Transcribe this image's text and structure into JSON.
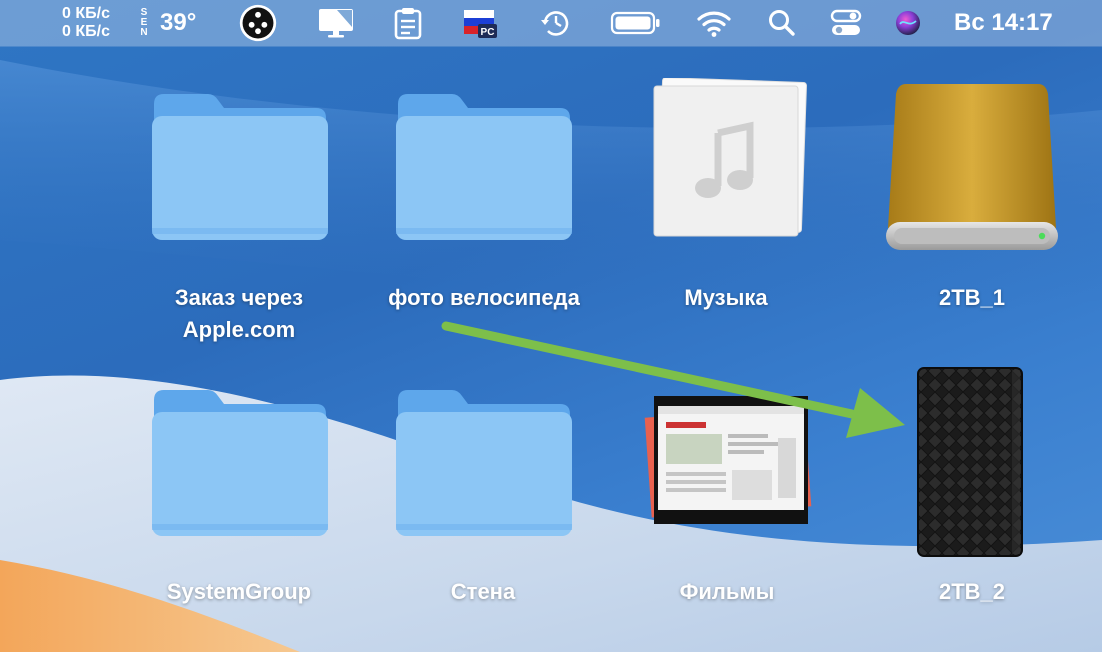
{
  "menubar": {
    "net_up": "0 КБ/с",
    "net_down": "0 КБ/с",
    "sensor_letters": [
      "S",
      "E",
      "N"
    ],
    "temperature": "39°",
    "icons": [
      "monitor-app-icon",
      "display-icon",
      "clipboard-icon",
      "russian-flag-input-icon",
      "time-machine-icon",
      "battery-icon",
      "wifi-icon",
      "search-icon",
      "control-center-icon",
      "siri-icon"
    ],
    "input_source_label": "PC",
    "clock": "Вс 14:17"
  },
  "desktop": {
    "items": [
      {
        "label_line1": "Заказ через",
        "label_line2": "Apple.com",
        "kind": "folder"
      },
      {
        "label_line1": "фото велосипеда",
        "kind": "folder"
      },
      {
        "label_line1": "Музыка",
        "kind": "music-folder"
      },
      {
        "label_line1": "2TB_1",
        "kind": "gold-drive"
      },
      {
        "label_line1": "SystemGroup",
        "kind": "folder"
      },
      {
        "label_line1": "Стена",
        "kind": "folder"
      },
      {
        "label_line1": "Фильмы",
        "kind": "screenshot-stack"
      },
      {
        "label_line1": "2TB_2",
        "kind": "black-drive"
      }
    ]
  },
  "colors": {
    "folder": "#8cc6f5",
    "folder_tab": "#5ea7eb",
    "arrow": "#7dbf4a",
    "gold_drive": "#c59a2c"
  }
}
